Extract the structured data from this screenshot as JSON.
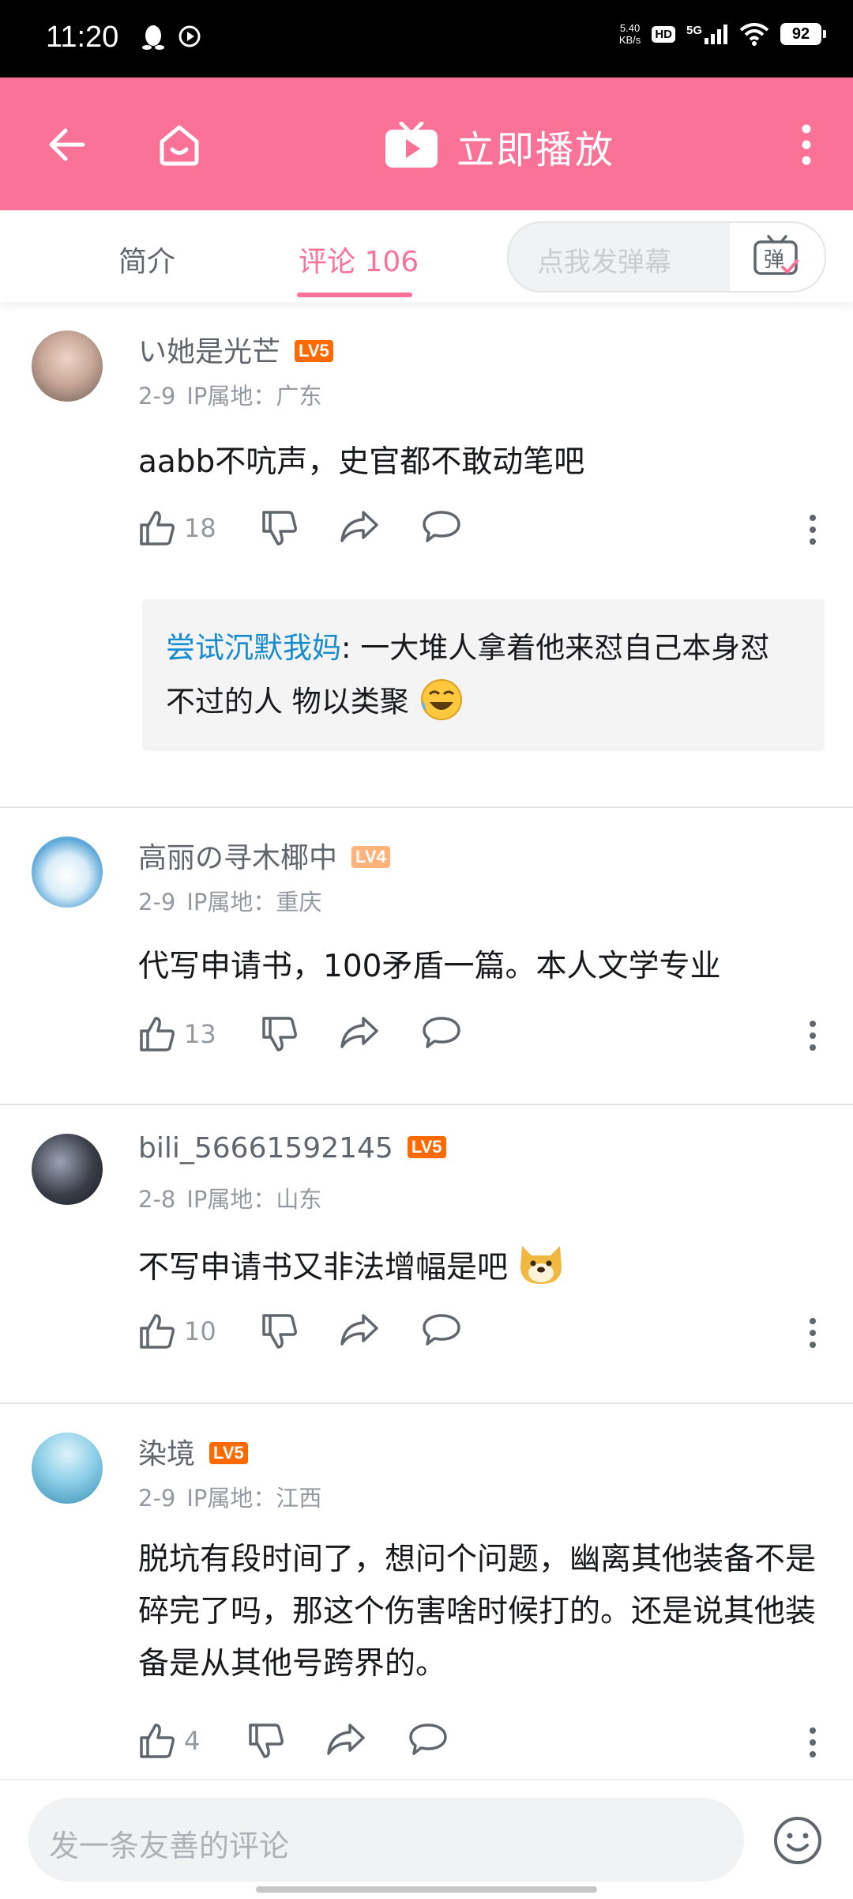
{
  "status_bar": {
    "time": "11:20",
    "net_speed_value": "5.40",
    "net_speed_unit": "KB/s",
    "hd": "HD",
    "signal": "5G",
    "battery": "92"
  },
  "header": {
    "play_now_label": "立即播放",
    "icons": [
      "back-arrow-icon",
      "home-icon",
      "tv-play-icon",
      "more-vertical-icon"
    ],
    "accent_color": "#fb7299"
  },
  "tabs": {
    "intro_label": "简介",
    "comments_label": "评论 106",
    "danmaku_placeholder": "点我发弹幕",
    "danmaku_button_label": "弹"
  },
  "comments": [
    {
      "username": "い她是光芒",
      "level": "LV5",
      "date": "2-9",
      "ip_location": "IP属地：广东",
      "text": "aabb不吭声，史官都不敢动笔吧",
      "likes": "18",
      "reply": {
        "username": "尝试沉默我妈",
        "separator": ": ",
        "text": "一大堆人拿着他来怼自己本身怼不过的人 物以类聚"
      }
    },
    {
      "username": "高丽の寻木椰中",
      "level": "LV4",
      "date": "2-9",
      "ip_location": "IP属地：重庆",
      "text": "代写申请书，100矛盾一篇。本人文学专业",
      "likes": "13"
    },
    {
      "username": "bili_56661592145",
      "level": "LV5",
      "date": "2-8",
      "ip_location": "IP属地：山东",
      "text": "不写申请书又非法增幅是吧",
      "likes": "10"
    },
    {
      "username": "染境",
      "level": "LV5",
      "date": "2-9",
      "ip_location": "IP属地：江西",
      "text": "脱坑有段时间了，想问个问题，幽离其他装备不是碎完了吗，那这个伤害啥时候打的。还是说其他装备是从其他号跨界的。",
      "likes": "4"
    }
  ],
  "bottom_bar": {
    "comment_placeholder": "发一条友善的评论",
    "emoji_icon": "smiley-icon"
  }
}
